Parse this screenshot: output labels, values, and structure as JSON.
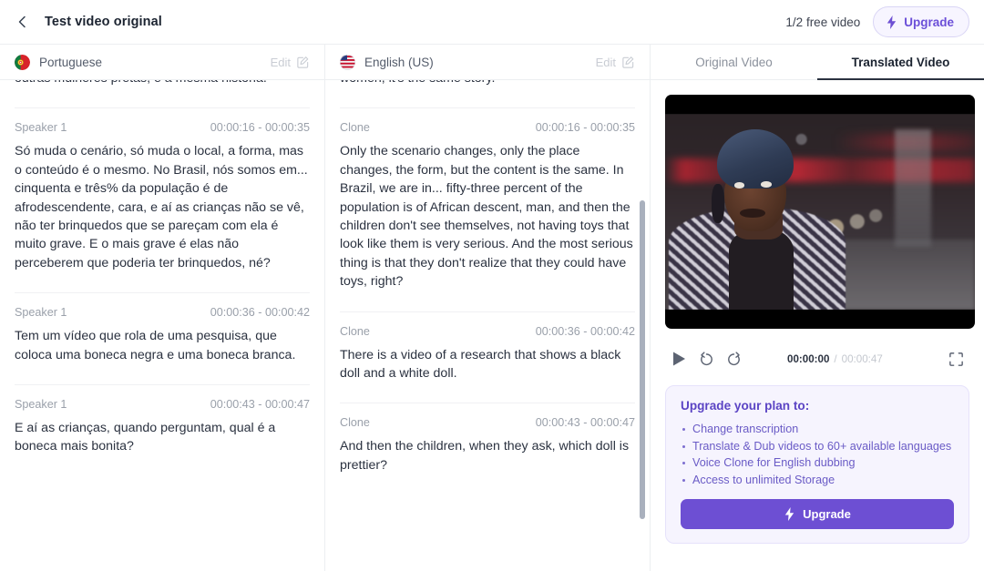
{
  "header": {
    "back_icon": "chevron-left-icon",
    "title": "Test video original",
    "free_video_count": "1/2 free video",
    "upgrade_label": "Upgrade",
    "bolt_icon": "bolt-icon"
  },
  "transcript": {
    "columns": [
      {
        "flag": "portugal-flag-icon",
        "language": "Portuguese",
        "edit_label": "Edit",
        "edit_icon": "pencil-square-icon",
        "segments": [
          {
            "speaker": "",
            "timecode": "",
            "text": "outras mulheres pretas, é a mesma história."
          },
          {
            "speaker": "Speaker 1",
            "timecode": "00:00:16 - 00:00:35",
            "text": "Só muda o cenário, só muda o local, a forma, mas o conteúdo é o mesmo. No Brasil, nós somos em... cinquenta e três% da população é de afrodescendente, cara, e aí as crianças não se vê, não ter brinquedos que se pareçam com ela é muito grave. E o mais grave é elas não perceberem que poderia ter brinquedos, né?"
          },
          {
            "speaker": "Speaker 1",
            "timecode": "00:00:36 - 00:00:42",
            "text": "Tem um vídeo que rola de uma pesquisa, que coloca uma boneca negra e uma boneca branca."
          },
          {
            "speaker": "Speaker 1",
            "timecode": "00:00:43 - 00:00:47",
            "text": "E aí as crianças, quando perguntam, qual é a boneca mais bonita?"
          }
        ]
      },
      {
        "flag": "usa-flag-icon",
        "language": "English (US)",
        "edit_label": "Edit",
        "edit_icon": "pencil-square-icon",
        "segments": [
          {
            "speaker": "",
            "timecode": "",
            "text": "women, it's the same story."
          },
          {
            "speaker": "Clone",
            "timecode": "00:00:16 - 00:00:35",
            "text": "Only the scenario changes, only the place changes, the form, but the content is the same. In Brazil, we are in... fifty-three percent of the population is of African descent, man, and then the children don't see themselves, not having toys that look like them is very serious. And the most serious thing is that they don't realize that they could have toys, right?"
          },
          {
            "speaker": "Clone",
            "timecode": "00:00:36 - 00:00:42",
            "text": "There is a video of a research that shows a black doll and a white doll."
          },
          {
            "speaker": "Clone",
            "timecode": "00:00:43 - 00:00:47",
            "text": "And then the children, when they ask, which doll is prettier?"
          }
        ]
      }
    ]
  },
  "video_panel": {
    "tabs": [
      {
        "label": "Original Video",
        "active": false
      },
      {
        "label": "Translated Video",
        "active": true
      }
    ],
    "player": {
      "play_icon": "play-icon",
      "rewind_icon": "rewind-10-icon",
      "forward_icon": "forward-10-icon",
      "fullscreen_icon": "fullscreen-icon",
      "current_time": "00:00:00",
      "time_separator": "/",
      "total_time": "00:00:47"
    },
    "upgrade_card": {
      "title": "Upgrade your plan to:",
      "items": [
        "Change transcription",
        "Translate & Dub videos to 60+ available languages",
        "Voice Clone for English dubbing",
        "Access to unlimited Storage"
      ],
      "button_label": "Upgrade",
      "bolt_icon": "bolt-icon"
    }
  },
  "colors": {
    "accent": "#6d4fd3",
    "accent_soft": "#f6f4fe",
    "text": "#2b3240",
    "muted": "#9aa0aa"
  }
}
